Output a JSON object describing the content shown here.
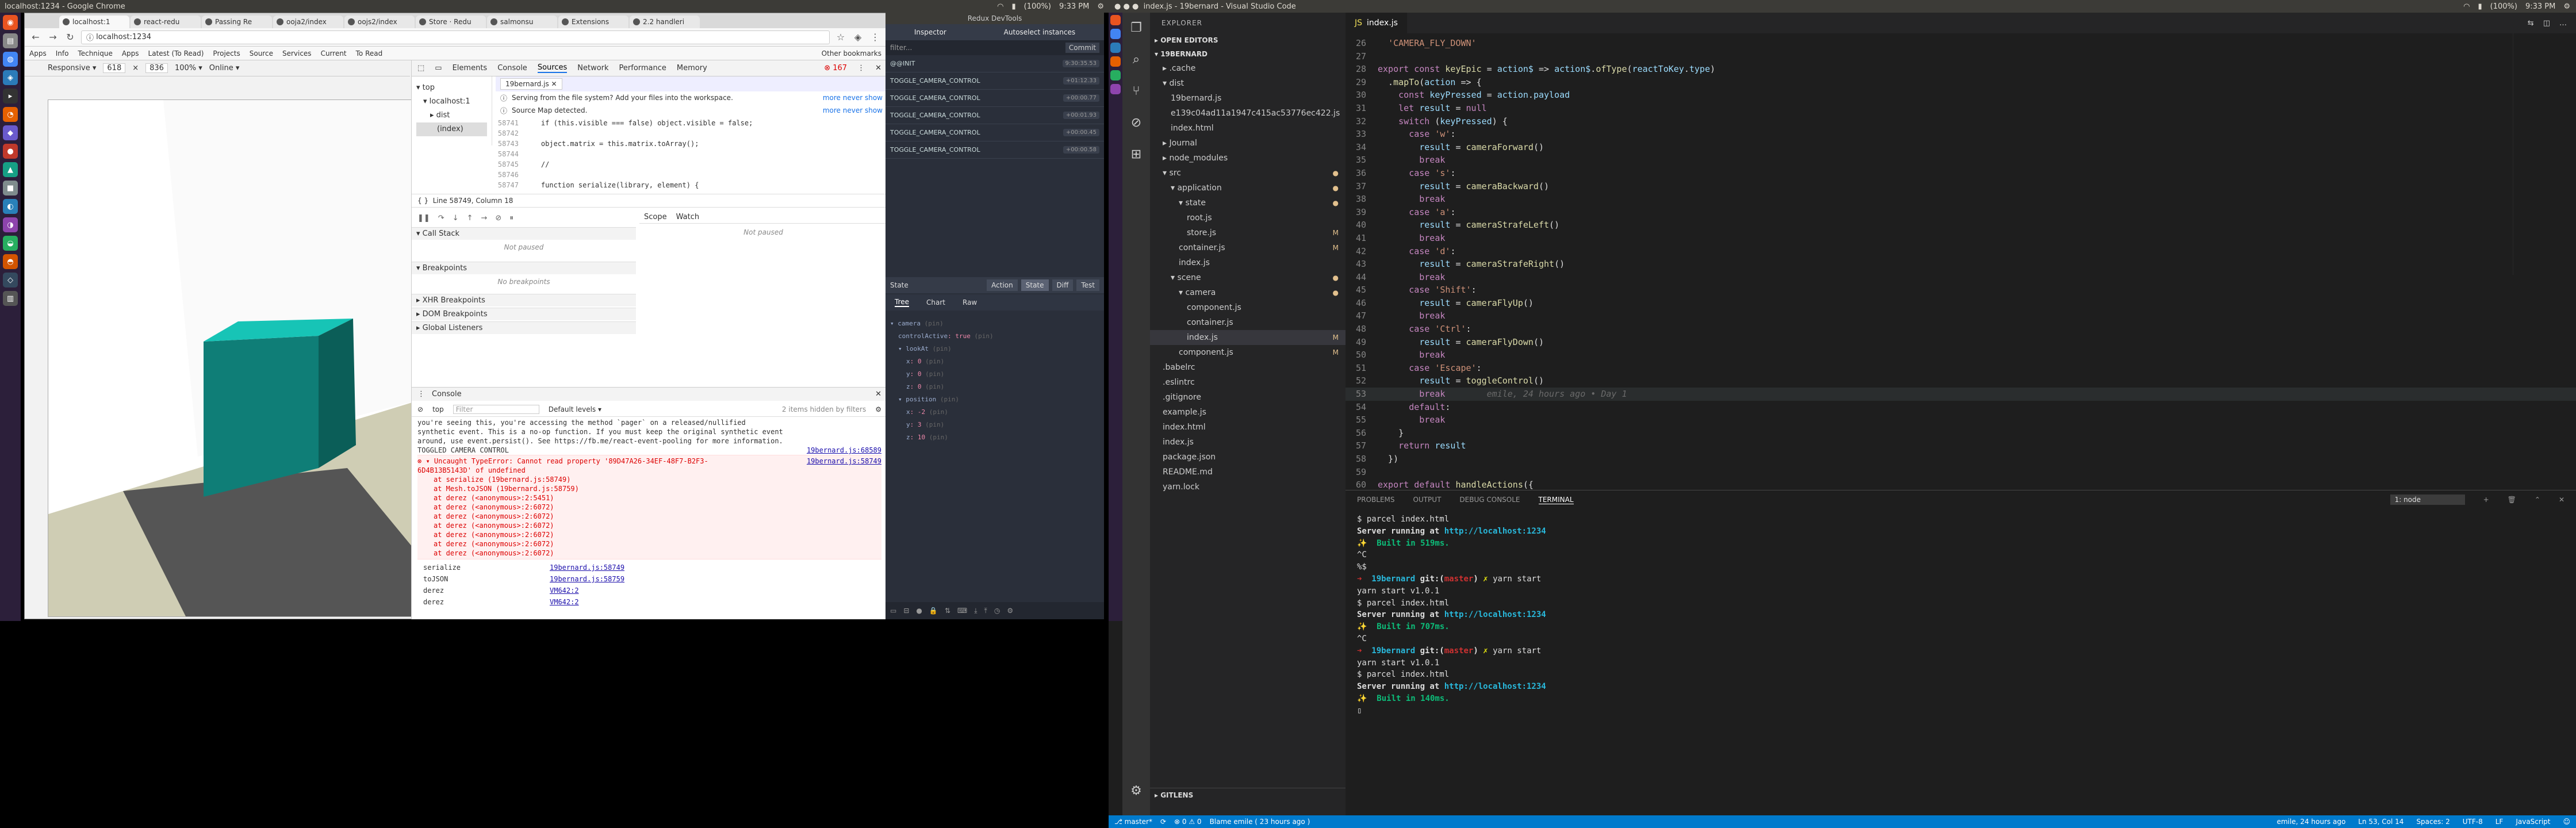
{
  "left": {
    "topbar_title": "localhost:1234 - Google Chrome",
    "tray": [
      "(100%)",
      "9:33 PM"
    ],
    "chrome": {
      "tabs": [
        "localhost:1",
        "react-redu",
        "Passing Re",
        "ooja2/index",
        "oojs2/index",
        "Store · Redu",
        "salmonsu",
        "Extensions",
        "2.2 handleri"
      ],
      "url": "localhost:1234",
      "bookmarks": [
        "Apps",
        "Info",
        "Technique",
        "Apps",
        "Latest (To Read)",
        "Projects",
        "Source",
        "Services",
        "Current",
        "To Read",
        "Other bookmarks"
      ],
      "viewport": {
        "device": "Responsive ▾",
        "width": "618",
        "height": "836",
        "zoom": "100% ▾",
        "network": "Online ▾"
      }
    },
    "devtools": {
      "tabs": [
        "Elements",
        "Console",
        "Sources",
        "Network",
        "Performance",
        "Memory"
      ],
      "active_tab": "Sources",
      "errors": "167",
      "tree": [
        "top",
        "localhost:1",
        "dist",
        "(index)"
      ],
      "file_tab": "19bernard.js",
      "notice1": "Serving from the file system? Add your files into the workspace.",
      "notice2": "Source Map detected.",
      "notice_links": "more   never show",
      "code": [
        {
          "n": "58741",
          "t": "    if (this.visible === false) object.visible = false;"
        },
        {
          "n": "58742",
          "t": ""
        },
        {
          "n": "58743",
          "t": "    object.matrix = this.matrix.toArray();"
        },
        {
          "n": "58744",
          "t": ""
        },
        {
          "n": "58745",
          "t": "    //"
        },
        {
          "n": "58746",
          "t": ""
        },
        {
          "n": "58747",
          "t": "    function serialize(library, element) {"
        }
      ],
      "status_line": "Line 58749, Column 18",
      "call_stack": "Call Stack",
      "not_paused": "Not paused",
      "breakpoints": "Breakpoints",
      "no_breakpoints": "No breakpoints",
      "xhr": "XHR Breakpoints",
      "dom": "DOM Breakpoints",
      "global": "Global Listeners",
      "scope": "Scope",
      "watch": "Watch",
      "scope_not_paused": "Not paused",
      "console": {
        "title": "Console",
        "context": "top",
        "filter": "Filter",
        "levels": "Default levels ▾",
        "hidden": "2 items hidden by filters",
        "lines": [
          "you're seeing this, you're accessing the method `pager` on a released/nullified",
          "synthetic event. This is a no-op function. If you must keep the original synthetic event",
          "around, use event.persist(). See https://fb.me/react-event-pooling for more information."
        ],
        "toggled": "TOGGLED CAMERA CONTROL",
        "toggled_src": "19bernard.js:68589",
        "error_head": "▾ Uncaught TypeError: Cannot read property '89D47A26-34EF-48F7-B2F3-",
        "error_head2": "  6D4B13B5143D' of undefined",
        "error_src": "19bernard.js:58749",
        "stack": [
          "at serialize (19bernard.js:58749)",
          "at Mesh.toJSON (19bernard.js:58759)",
          "at derez (<anonymous>:2:5451)",
          "at derez (<anonymous>:2:6072)",
          "at derez (<anonymous>:2:6072)",
          "at derez (<anonymous>:2:6072)",
          "at derez (<anonymous>:2:6072)",
          "at derez (<anonymous>:2:6072)",
          "at derez (<anonymous>:2:6072)"
        ],
        "frames": [
          {
            "fn": "serialize",
            "src": "19bernard.js:58749"
          },
          {
            "fn": "toJSON",
            "src": "19bernard.js:58759"
          },
          {
            "fn": "derez",
            "src": "VM642:2"
          },
          {
            "fn": "derez",
            "src": "VM642:2"
          }
        ]
      }
    },
    "redux": {
      "window_title": "Redux DevTools",
      "inspector": "Inspector",
      "instances": "Autoselect instances",
      "filter": "filter...",
      "commit": "Commit",
      "actions": [
        {
          "name": "@@INIT",
          "time": "9:30:35.53"
        },
        {
          "name": "TOGGLE_CAMERA_CONTROL",
          "time": "+01:12.33"
        },
        {
          "name": "TOGGLE_CAMERA_CONTROL",
          "time": "+00:00.77"
        },
        {
          "name": "TOGGLE_CAMERA_CONTROL",
          "time": "+00:01.93"
        },
        {
          "name": "TOGGLE_CAMERA_CONTROL",
          "time": "+00:00.45"
        },
        {
          "name": "TOGGLE_CAMERA_CONTROL",
          "time": "+00:00.58"
        }
      ],
      "state_label": "State",
      "state_tabs": [
        "Action",
        "State",
        "Diff",
        "Test"
      ],
      "sub_tabs": [
        "Tree",
        "Chart",
        "Raw"
      ],
      "tree": [
        {
          "indent": 0,
          "k": "▾ camera",
          "t": " (pin)",
          "v": ""
        },
        {
          "indent": 1,
          "k": "controlActive",
          "t": " (pin)",
          "v": ": true"
        },
        {
          "indent": 1,
          "k": "▾ lookAt",
          "t": " (pin)",
          "v": ""
        },
        {
          "indent": 2,
          "k": "x",
          "t": " (pin)",
          "v": ": 0"
        },
        {
          "indent": 2,
          "k": "y",
          "t": " (pin)",
          "v": ": 0"
        },
        {
          "indent": 2,
          "k": "z",
          "t": " (pin)",
          "v": ": 0"
        },
        {
          "indent": 1,
          "k": "▾ position",
          "t": " (pin)",
          "v": ""
        },
        {
          "indent": 2,
          "k": "x",
          "t": " (pin)",
          "v": ": -2"
        },
        {
          "indent": 2,
          "k": "y",
          "t": " (pin)",
          "v": ": 3"
        },
        {
          "indent": 2,
          "k": "z",
          "t": " (pin)",
          "v": ": 10"
        }
      ]
    }
  },
  "right": {
    "title": "index.js - 19bernard - Visual Studio Code",
    "tray": [
      "(100%)",
      "9:33 PM"
    ],
    "explorer": {
      "header": "EXPLORER",
      "open_editors": "▸ OPEN EDITORS",
      "project": "▾ 19BERNARD",
      "files": [
        {
          "d": 1,
          "name": "▸ .cache",
          "m": ""
        },
        {
          "d": 1,
          "name": "▾ dist",
          "m": ""
        },
        {
          "d": 2,
          "name": "19bernard.js",
          "m": ""
        },
        {
          "d": 2,
          "name": "e139c04ad11a1947c415ac53776ec422.js",
          "m": ""
        },
        {
          "d": 2,
          "name": "index.html",
          "m": ""
        },
        {
          "d": 1,
          "name": "▸ Journal",
          "m": ""
        },
        {
          "d": 1,
          "name": "▸ node_modules",
          "m": ""
        },
        {
          "d": 1,
          "name": "▾ src",
          "m": "●"
        },
        {
          "d": 2,
          "name": "▾ application",
          "m": "●"
        },
        {
          "d": 3,
          "name": "▾ state",
          "m": "●"
        },
        {
          "d": 4,
          "name": "root.js",
          "m": ""
        },
        {
          "d": 4,
          "name": "store.js",
          "m": "M"
        },
        {
          "d": 3,
          "name": "container.js",
          "m": "M"
        },
        {
          "d": 3,
          "name": "index.js",
          "m": ""
        },
        {
          "d": 2,
          "name": "▾ scene",
          "m": "●"
        },
        {
          "d": 3,
          "name": "▾ camera",
          "m": "●"
        },
        {
          "d": 4,
          "name": "component.js",
          "m": ""
        },
        {
          "d": 4,
          "name": "container.js",
          "m": ""
        },
        {
          "d": 4,
          "name": "index.js",
          "m": "M"
        },
        {
          "d": 3,
          "name": "component.js",
          "m": "M"
        },
        {
          "d": 1,
          "name": ".babelrc",
          "m": ""
        },
        {
          "d": 1,
          "name": ".eslintrc",
          "m": ""
        },
        {
          "d": 1,
          "name": ".gitignore",
          "m": ""
        },
        {
          "d": 1,
          "name": "example.js",
          "m": ""
        },
        {
          "d": 1,
          "name": "index.html",
          "m": ""
        },
        {
          "d": 1,
          "name": "index.js",
          "m": ""
        },
        {
          "d": 1,
          "name": "package.json",
          "m": ""
        },
        {
          "d": 1,
          "name": "README.md",
          "m": ""
        },
        {
          "d": 1,
          "name": "yarn.lock",
          "m": ""
        }
      ],
      "gitlens": "▸ GITLENS"
    },
    "editor_tab": "index.js",
    "code": [
      {
        "n": "26",
        "h": "  <span class='str'>'CAMERA_FLY_DOWN'</span>"
      },
      {
        "n": "27",
        "h": ""
      },
      {
        "n": "28",
        "h": "<span class='kw'>export const</span> <span class='fn'>keyEpic</span> = <span class='var'>action$</span> => <span class='var'>action$</span>.<span class='fn'>ofType</span>(<span class='var'>reactToKey</span>.<span class='var'>type</span>)"
      },
      {
        "n": "29",
        "h": "  .<span class='fn'>mapTo</span>(<span class='var'>action</span> => {"
      },
      {
        "n": "30",
        "h": "    <span class='kw'>const</span> <span class='var'>keyPressed</span> = <span class='var'>action</span>.<span class='var'>payload</span>"
      },
      {
        "n": "31",
        "h": "    <span class='kw'>let</span> <span class='var'>result</span> = <span class='kw'>null</span>"
      },
      {
        "n": "32",
        "h": "    <span class='kw'>switch</span> (<span class='var'>keyPressed</span>) {"
      },
      {
        "n": "33",
        "h": "      <span class='kw'>case</span> <span class='str'>'w'</span>:"
      },
      {
        "n": "34",
        "h": "        <span class='var'>result</span> = <span class='fn'>cameraForward</span>()"
      },
      {
        "n": "35",
        "h": "        <span class='kw'>break</span>"
      },
      {
        "n": "36",
        "h": "      <span class='kw'>case</span> <span class='str'>'s'</span>:"
      },
      {
        "n": "37",
        "h": "        <span class='var'>result</span> = <span class='fn'>cameraBackward</span>()"
      },
      {
        "n": "38",
        "h": "        <span class='kw'>break</span>"
      },
      {
        "n": "39",
        "h": "      <span class='kw'>case</span> <span class='str'>'a'</span>:"
      },
      {
        "n": "40",
        "h": "        <span class='var'>result</span> = <span class='fn'>cameraStrafeLeft</span>()"
      },
      {
        "n": "41",
        "h": "        <span class='kw'>break</span>"
      },
      {
        "n": "42",
        "h": "      <span class='kw'>case</span> <span class='str'>'d'</span>:"
      },
      {
        "n": "43",
        "h": "        <span class='var'>result</span> = <span class='fn'>cameraStrafeRight</span>()"
      },
      {
        "n": "44",
        "h": "        <span class='kw'>break</span>"
      },
      {
        "n": "45",
        "h": "      <span class='kw'>case</span> <span class='str'>'Shift'</span>:"
      },
      {
        "n": "46",
        "h": "        <span class='var'>result</span> = <span class='fn'>cameraFlyUp</span>()"
      },
      {
        "n": "47",
        "h": "        <span class='kw'>break</span>"
      },
      {
        "n": "48",
        "h": "      <span class='kw'>case</span> <span class='str'>'Ctrl'</span>:"
      },
      {
        "n": "49",
        "h": "        <span class='var'>result</span> = <span class='fn'>cameraFlyDown</span>()"
      },
      {
        "n": "50",
        "h": "        <span class='kw'>break</span>"
      },
      {
        "n": "51",
        "h": "      <span class='kw'>case</span> <span class='str'>'Escape'</span>:"
      },
      {
        "n": "52",
        "h": "        <span class='var'>result</span> = <span class='fn'>toggleControl</span>()"
      },
      {
        "n": "53",
        "h": "        <span class='kw'>break</span>        <span class='blame'>emile, 24 hours ago • Day 1</span>",
        "cur": true
      },
      {
        "n": "54",
        "h": "      <span class='kw'>default</span>:"
      },
      {
        "n": "55",
        "h": "        <span class='kw'>break</span>"
      },
      {
        "n": "56",
        "h": "    }"
      },
      {
        "n": "57",
        "h": "    <span class='kw'>return</span> <span class='var'>result</span>"
      },
      {
        "n": "58",
        "h": "  })"
      },
      {
        "n": "59",
        "h": ""
      },
      {
        "n": "60",
        "h": "<span class='kw'>export default</span> <span class='fn'>handleActions</span>({"
      }
    ],
    "panel_tabs": [
      "PROBLEMS",
      "OUTPUT",
      "DEBUG CONSOLE",
      "TERMINAL"
    ],
    "terminal_select": "1: node",
    "terminal": [
      "<span>$ parcel index.html</span>",
      "<span class='b'>Server running at <span class='cy'>http://localhost:1234</span></span>",
      "<span class='gr b'>✨  Built in 519ms.</span>",
      "<span>^C</span>",
      "<span>%$</span>",
      "<span class='rd b'>➜  </span><span class='cy b'>19bernard</span> <span class='b'>git:(</span><span class='rd b'>master</span><span class='b'>)</span> <span class='yl b'>✗</span> yarn start",
      "<span>yarn start v1.0.1</span>",
      "<span>$ parcel index.html</span>",
      "<span class='b'>Server running at <span class='cy'>http://localhost:1234</span></span>",
      "<span class='gr b'>✨  Built in 707ms.</span>",
      "<span>^C</span>",
      "<span class='rd b'>➜  </span><span class='cy b'>19bernard</span> <span class='b'>git:(</span><span class='rd b'>master</span><span class='b'>)</span> <span class='yl b'>✗</span> yarn start",
      "<span>yarn start v1.0.1</span>",
      "<span>$ parcel index.html</span>",
      "<span class='b'>Server running at <span class='cy'>http://localhost:1234</span></span>",
      "<span class='gr b'>✨  Built in 140ms.</span>",
      "<span>▯</span>"
    ],
    "status": {
      "branch": "⎇ master*",
      "sync": "⟳",
      "problems": "⊗ 0 ⚠ 0",
      "blame": "Blame emile ( 23 hours ago )",
      "right": [
        "emile, 24 hours ago",
        "Ln 53, Col 14",
        "Spaces: 2",
        "UTF-8",
        "LF",
        "JavaScript",
        "☺"
      ]
    }
  }
}
